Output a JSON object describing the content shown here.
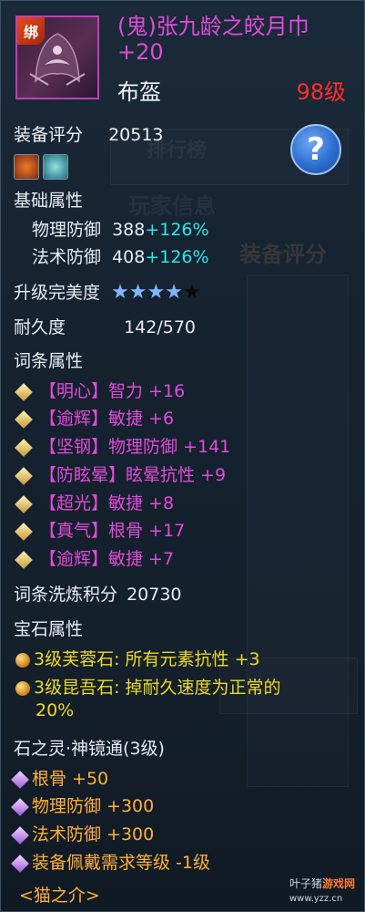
{
  "item": {
    "bind_tag": "绑",
    "name": "(鬼)张九龄之皎月巾 +20",
    "type": "布盔",
    "level": "98级"
  },
  "score": {
    "label": "装备评分",
    "value": "20513"
  },
  "help_icon": "?",
  "base": {
    "title": "基础属性",
    "stats": [
      {
        "name": "物理防御",
        "value": "388",
        "bonus": "+126%"
      },
      {
        "name": "法术防御",
        "value": "408",
        "bonus": "+126%"
      }
    ]
  },
  "perfection": {
    "label": "升级完美度",
    "stars_filled": 4,
    "stars_total": 5
  },
  "durability": {
    "label": "耐久度",
    "value": "142/570"
  },
  "affixes": {
    "title": "词条属性",
    "items": [
      {
        "tag": "【明心】",
        "text": "智力 +16"
      },
      {
        "tag": "【逾辉】",
        "text": "敏捷 +6"
      },
      {
        "tag": "【坚钢】",
        "text": "物理防御 +141"
      },
      {
        "tag": "【防眩晕】",
        "text": "眩晕抗性 +9"
      },
      {
        "tag": "【超光】",
        "text": "敏捷 +8"
      },
      {
        "tag": "【真气】",
        "text": "根骨 +17"
      },
      {
        "tag": "【逾辉】",
        "text": "敏捷 +7"
      }
    ]
  },
  "refine_score": {
    "label": "词条洗炼积分",
    "value": "20730"
  },
  "gems": {
    "title": "宝石属性",
    "items": [
      {
        "line1": "3级芙蓉石: 所有元素抗性 +3",
        "line2": ""
      },
      {
        "line1": "3级昆吾石: 掉耐久速度为正常的",
        "line2": "20%"
      }
    ]
  },
  "spirit": {
    "title": "石之灵·神镜通(3级)",
    "items": [
      "根骨 +50",
      "物理防御 +300",
      "法术防御 +300",
      "装备佩戴需求等级 -1级"
    ]
  },
  "crafter": "<猫之介>",
  "watermark": {
    "ranking": "排行榜",
    "player_info": "玩家信息",
    "equip_score": "装备评分"
  },
  "footer": {
    "brand": "叶子猪",
    "tag": "游戏网",
    "url": "www.yzz.cn"
  },
  "colors": {
    "name": "#e04bd8",
    "level": "#ff2d2d",
    "bonus": "#2ee7ea",
    "affix": "#e04bd8",
    "gem": "#ecd92a",
    "spirit": "#ffb03a",
    "star": "#7fb6ff"
  }
}
